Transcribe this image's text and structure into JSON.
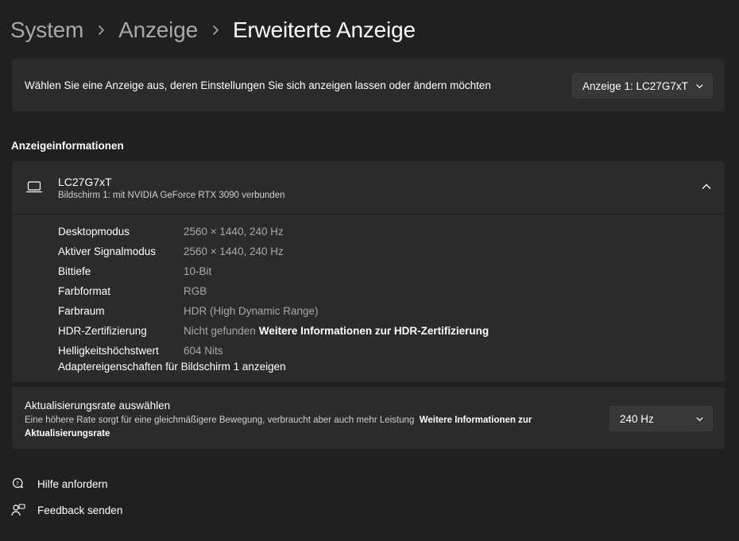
{
  "breadcrumb": {
    "items": [
      "System",
      "Anzeige",
      "Erweiterte Anzeige"
    ]
  },
  "display_select": {
    "label": "Wählen Sie eine Anzeige aus, deren Einstellungen Sie sich anzeigen lassen oder ändern möchten",
    "selected": "Anzeige 1: LC27G7xT"
  },
  "section": {
    "title": "Anzeigeinformationen"
  },
  "display_info": {
    "name": "LC27G7xT",
    "subtitle": "Bildschirm 1: mit NVIDIA GeForce RTX 3090 verbunden",
    "rows": [
      {
        "key": "Desktopmodus",
        "value": "2560 × 1440, 240 Hz"
      },
      {
        "key": "Aktiver Signalmodus",
        "value": "2560 × 1440, 240 Hz"
      },
      {
        "key": "Bittiefe",
        "value": "10-Bit"
      },
      {
        "key": "Farbformat",
        "value": "RGB"
      },
      {
        "key": "Farbraum",
        "value": "HDR (High Dynamic Range)"
      },
      {
        "key": "HDR-Zertifizierung",
        "value": "Nicht gefunden",
        "link": "Weitere Informationen zur HDR-Zertifizierung"
      },
      {
        "key": "Helligkeitshöchstwert",
        "value": "604 Nits"
      }
    ],
    "adapter_link": "Adaptereigenschaften für Bildschirm 1 anzeigen"
  },
  "refresh_rate": {
    "title": "Aktualisierungsrate auswählen",
    "description": "Eine höhere Rate sorgt für eine gleichmäßigere Bewegung, verbraucht aber auch mehr Leistung",
    "link": "Weitere Informationen zur Aktualisierungsrate",
    "selected": "240 Hz"
  },
  "footer": {
    "help": "Hilfe anfordern",
    "feedback": "Feedback senden"
  },
  "icons": {
    "breadcrumb_separator": "chevron-right-icon",
    "dropdown": "chevron-down-icon",
    "collapse": "chevron-up-icon",
    "monitor": "laptop-icon",
    "help": "help-chat-icon",
    "feedback": "feedback-icon"
  },
  "colors": {
    "background": "#202020",
    "card": "#2b2b2b",
    "muted_text": "#a8a8a8"
  }
}
